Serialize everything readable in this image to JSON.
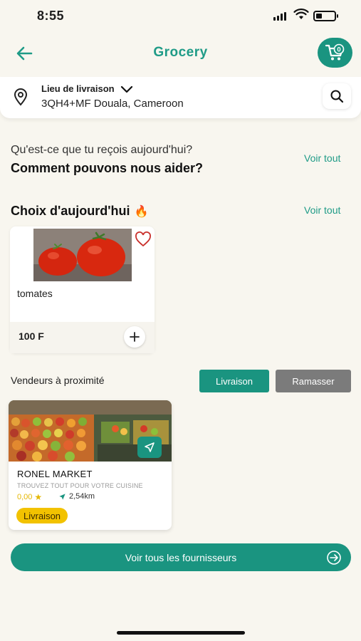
{
  "status_bar": {
    "time": "8:55"
  },
  "header": {
    "title": "Grocery",
    "cart_count": "0"
  },
  "location": {
    "label": "Lieu de livraison",
    "address": "3QH4+MF Douala, Cameroon"
  },
  "question": {
    "line1": "Qu'est-ce que tu reçois aujourd'hui?",
    "line2": "Comment pouvons nous aider?",
    "see_all": "Voir tout"
  },
  "todays_choice": {
    "title": "Choix d'aujourd'hui",
    "emoji": "🔥",
    "see_all": "Voir tout",
    "products": [
      {
        "name": "tomates",
        "price": "100 F"
      }
    ]
  },
  "vendors": {
    "title": "Vendeurs à proximité",
    "filters": [
      "Livraison",
      "Ramasser"
    ],
    "items": [
      {
        "name": "RONEL MARKET",
        "tagline": "TROUVEZ TOUT POUR VOTRE CUISINE",
        "rating": "0,00",
        "distance": "2,54km",
        "badge": "Livraison"
      }
    ]
  },
  "cta": {
    "label": "Voir tous les fournisseurs"
  },
  "colors": {
    "brand": "#1a9480",
    "accent": "#f2c200",
    "background": "#f8f6ef",
    "secondary": "#7b7b7b"
  }
}
